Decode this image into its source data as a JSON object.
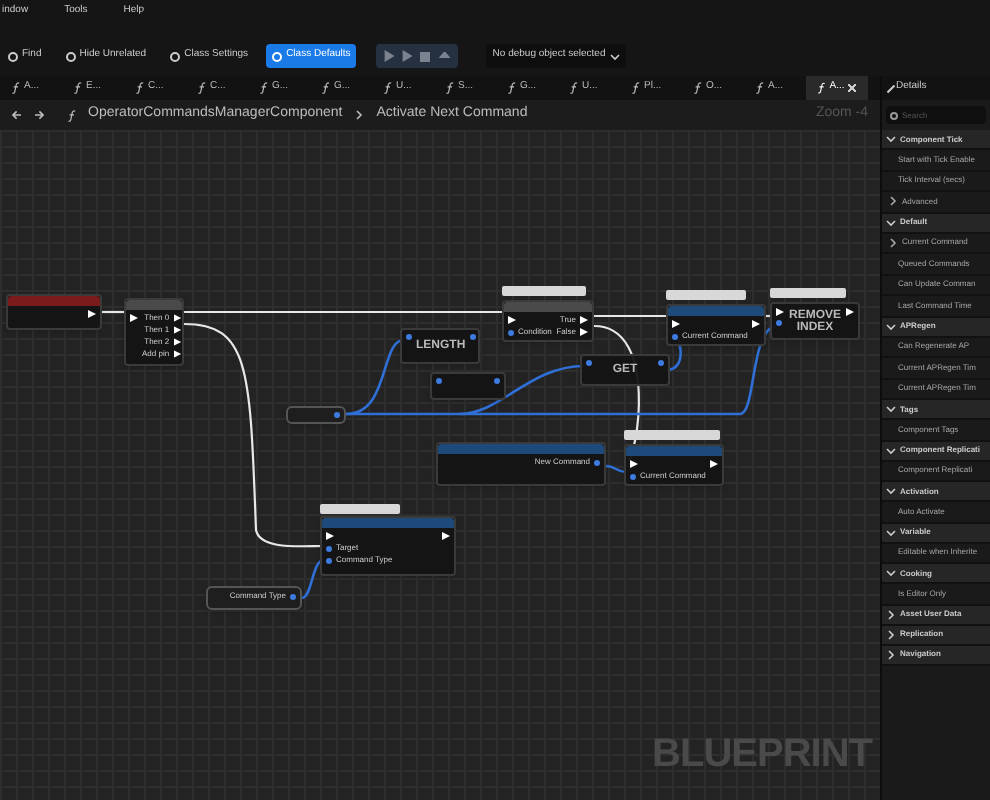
{
  "menu": [
    "indow",
    "Tools",
    "Help"
  ],
  "toolbar": [
    {
      "label": "Find",
      "highlighted": false
    },
    {
      "label": "Hide Unrelated",
      "highlighted": false
    },
    {
      "label": "Class Settings",
      "highlighted": false
    },
    {
      "label": "Class Defaults",
      "highlighted": true
    }
  ],
  "debug_dropdown": "No debug object selected",
  "tabs": [
    {
      "label": "A...",
      "selected": false
    },
    {
      "label": "E...",
      "selected": false
    },
    {
      "label": "C...",
      "selected": false
    },
    {
      "label": "C...",
      "selected": false
    },
    {
      "label": "G...",
      "selected": false
    },
    {
      "label": "G...",
      "selected": false
    },
    {
      "label": "U...",
      "selected": false
    },
    {
      "label": "S...",
      "selected": false
    },
    {
      "label": "G...",
      "selected": false
    },
    {
      "label": "U...",
      "selected": false
    },
    {
      "label": "Pl...",
      "selected": false
    },
    {
      "label": "O...",
      "selected": false
    },
    {
      "label": "A...",
      "selected": false
    },
    {
      "label": "A...",
      "selected": true
    }
  ],
  "breadcrumb": {
    "path": "OperatorCommandsManagerComponent",
    "current": "Activate Next Command",
    "zoom": "Zoom -4"
  },
  "graph": {
    "watermark": "BLUEPRINT",
    "nodes": [
      {
        "kind": "event",
        "outputs": [
          {
            "kind": "exec"
          }
        ]
      },
      {
        "kind": "flow",
        "inputs": [
          {
            "kind": "exec"
          }
        ],
        "outputs": [
          {
            "kind": "exec",
            "label": "Then 0"
          },
          {
            "kind": "exec",
            "label": "Then 1"
          },
          {
            "kind": "exec",
            "label": "Then 2"
          },
          {
            "kind": "exec",
            "label": "Add pin"
          }
        ]
      },
      {
        "kind": "flow",
        "inputs": [
          {
            "kind": "exec"
          },
          {
            "kind": "data",
            "label": "Condition"
          }
        ],
        "outputs": [
          {
            "kind": "exec",
            "label": "True"
          },
          {
            "kind": "exec",
            "label": "False"
          }
        ]
      },
      {
        "kind": "pure",
        "title": "LENGTH",
        "inputs": [
          {
            "kind": "data"
          }
        ],
        "outputs": [
          {
            "kind": "data"
          }
        ]
      },
      {
        "kind": "pure",
        "inputs": [
          {
            "kind": "data"
          }
        ],
        "outputs": [
          {
            "kind": "data"
          }
        ]
      },
      {
        "kind": "var",
        "outputs": [
          {
            "kind": "data"
          }
        ]
      },
      {
        "kind": "pure",
        "title": "GET",
        "inputs": [
          {
            "kind": "data"
          }
        ],
        "outputs": [
          {
            "kind": "data"
          }
        ]
      },
      {
        "kind": "call",
        "inputs": [
          {
            "kind": "exec"
          },
          {
            "kind": "data",
            "label": "Current Command"
          }
        ],
        "outputs": [
          {
            "kind": "exec"
          }
        ]
      },
      {
        "kind": "pure",
        "title": "REMOVE INDEX",
        "inputs": [
          {
            "kind": "exec"
          },
          {
            "kind": "data"
          }
        ],
        "outputs": [
          {
            "kind": "exec"
          }
        ]
      },
      {
        "kind": "call",
        "outputs": [
          {
            "kind": "data",
            "label": "New Command"
          }
        ]
      },
      {
        "kind": "call",
        "inputs": [
          {
            "kind": "exec"
          },
          {
            "kind": "data",
            "label": "Current Command"
          }
        ],
        "outputs": [
          {
            "kind": "exec"
          }
        ]
      },
      {
        "kind": "call",
        "inputs": [
          {
            "kind": "exec"
          },
          {
            "kind": "data",
            "label": "Target"
          },
          {
            "kind": "data",
            "label": "Command Type"
          }
        ],
        "outputs": [
          {
            "kind": "exec"
          }
        ]
      },
      {
        "kind": "var",
        "outputs": [
          {
            "kind": "data",
            "label": "Command Type"
          }
        ]
      }
    ]
  },
  "details": {
    "title": "Details",
    "search": {
      "placeholder": "Search"
    },
    "sections": [
      {
        "title": "Component Tick",
        "expanded": true,
        "items": [
          {
            "kind": "property",
            "label": "Start with Tick Enable"
          },
          {
            "kind": "property",
            "label": "Tick Interval (secs)"
          },
          {
            "kind": "group",
            "label": "Advanced"
          }
        ]
      },
      {
        "title": "Default",
        "expanded": true,
        "items": [
          {
            "kind": "group",
            "label": "Current Command"
          },
          {
            "kind": "property",
            "label": "Queued Commands"
          },
          {
            "kind": "property",
            "label": "Can Update Comman"
          },
          {
            "kind": "property",
            "label": "Last Command Time"
          }
        ]
      },
      {
        "title": "APRegen",
        "expanded": true,
        "items": [
          {
            "kind": "property",
            "label": "Can Regenerate AP"
          },
          {
            "kind": "property",
            "label": "Current APRegen Tim"
          },
          {
            "kind": "property",
            "label": "Current APRegen Tim"
          }
        ]
      },
      {
        "title": "Tags",
        "expanded": true,
        "items": [
          {
            "kind": "property",
            "label": "Component Tags"
          }
        ]
      },
      {
        "title": "Component Replicati",
        "expanded": true,
        "items": [
          {
            "kind": "property",
            "label": "Component Replicati"
          }
        ]
      },
      {
        "title": "Activation",
        "expanded": true,
        "items": [
          {
            "kind": "property",
            "label": "Auto Activate"
          }
        ]
      },
      {
        "title": "Variable",
        "expanded": true,
        "items": [
          {
            "kind": "property",
            "label": "Editable when Inherite"
          }
        ]
      },
      {
        "title": "Cooking",
        "expanded": true,
        "items": [
          {
            "kind": "property",
            "label": "Is Editor Only"
          }
        ]
      },
      {
        "title": "Asset User Data",
        "expanded": false
      },
      {
        "title": "Replication",
        "expanded": false
      },
      {
        "title": "Navigation",
        "expanded": false
      }
    ]
  }
}
